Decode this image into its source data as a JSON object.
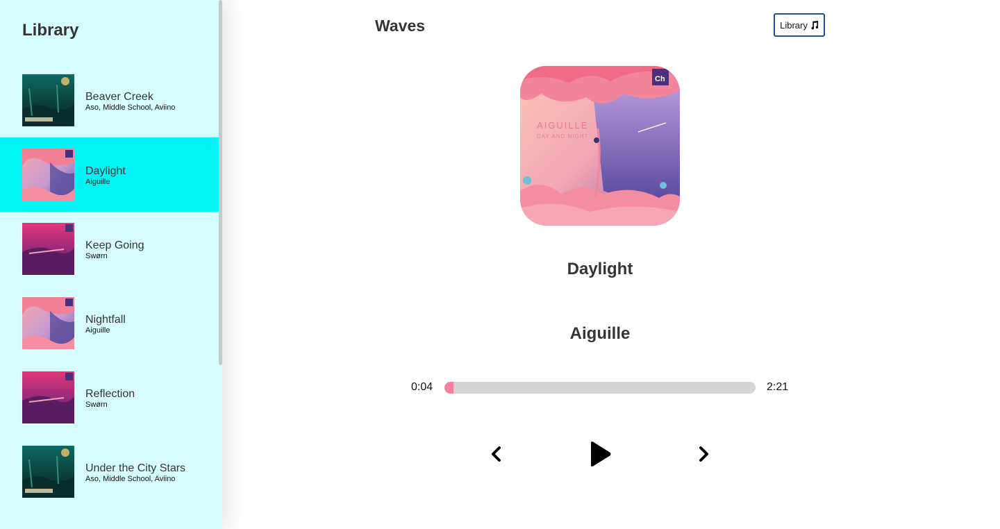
{
  "app": {
    "brand": "Waves",
    "library_button_label": "Library"
  },
  "library": {
    "title": "Library",
    "songs": [
      {
        "title": "Beaver Creek",
        "artist": "Aso, Middle School, Aviino",
        "cover": "forest-cover",
        "active": false
      },
      {
        "title": "Daylight",
        "artist": "Aiguille",
        "cover": "pink-cover",
        "active": true
      },
      {
        "title": "Keep Going",
        "artist": "Swørn",
        "cover": "magenta-cover",
        "active": false
      },
      {
        "title": "Nightfall",
        "artist": "Aiguille",
        "cover": "pink-cover",
        "active": false
      },
      {
        "title": "Reflection",
        "artist": "Swørn",
        "cover": "magenta-cover",
        "active": false
      },
      {
        "title": "Under the City Stars",
        "artist": "Aso, Middle School, Aviino",
        "cover": "forest-cover",
        "active": false
      }
    ]
  },
  "player": {
    "current_title": "Daylight",
    "current_artist": "Aiguille",
    "current_time": "0:04",
    "duration": "2:21",
    "progress_fraction": 0.028
  },
  "icons": {
    "library": "music-note-icon",
    "prev": "chevron-left-icon",
    "play": "play-icon",
    "next": "chevron-right-icon"
  },
  "colors": {
    "library_bg": "#d6fdff",
    "active_song_bg": "#00f6f6",
    "progress_fill": "#f7819f",
    "progress_track": "#d5d5d5",
    "library_button_border": "#1f4f99"
  }
}
